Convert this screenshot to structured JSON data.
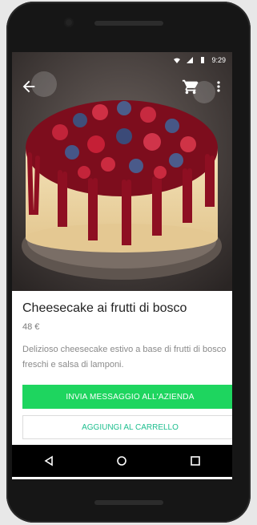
{
  "status_bar": {
    "time": "9:29"
  },
  "app_bar": {
    "back_icon": "arrow-back-icon",
    "cart_icon": "cart-icon",
    "more_icon": "more-vert-icon"
  },
  "product": {
    "title": "Cheesecake ai frutti di bosco",
    "price": "48 €",
    "description": "Delizioso cheesecake estivo a base di frutti di bosco freschi e salsa di lamponi."
  },
  "actions": {
    "message_label": "INVIA MESSAGGIO ALL'AZIENDA",
    "add_to_cart_label": "AGGIUNGI AL CARRELLO"
  },
  "colors": {
    "primary": "#1ed55f",
    "secondary_text": "#1fbf8f"
  }
}
